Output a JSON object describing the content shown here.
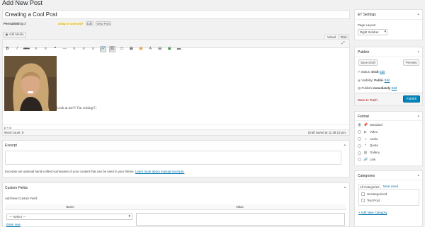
{
  "page": {
    "title": "Add New Post"
  },
  "post": {
    "title": "Creating a Cool Post",
    "permalink_label": "Permalink:",
    "permalink_url": "http://",
    "slug": "using-a-cool-post/",
    "edit_btn": "Edit",
    "view_btn": "View Post"
  },
  "editor": {
    "add_media": "Add Media",
    "tab_visual": "Visual",
    "tab_text": "Text",
    "content": "Look at me!!! I'm writing!!!",
    "path": "p » a",
    "word_count": "Word count: 9",
    "draft_saved": "Draft saved at 11:28:13 pm."
  },
  "excerpt": {
    "title": "Excerpt",
    "help": "Excerpts are optional hand-crafted summaries of your content that can be used in your theme.",
    "help_link": "Learn more about manual excerpts."
  },
  "custom_fields": {
    "title": "Custom Fields",
    "add_new": "Add New Custom Field:",
    "col_name": "Name",
    "col_value": "Value",
    "select_placeholder": "— Select —",
    "enter_new": "Enter new"
  },
  "et_settings": {
    "title": "ET Settings",
    "page_layout_label": "Page Layout:",
    "page_layout_value": "Right Sidebar"
  },
  "publish": {
    "title": "Publish",
    "save_draft": "Save Draft",
    "preview": "Preview",
    "status_label": "Status:",
    "status_value": "Draft",
    "visibility_label": "Visibility:",
    "visibility_value": "Public",
    "publish_label": "Publish",
    "publish_value": "immediately",
    "edit": "Edit",
    "move_trash": "Move to Trash",
    "publish_btn": "Publish"
  },
  "format": {
    "title": "Format",
    "options": [
      {
        "label": "Standard",
        "icon": "pin-icon"
      },
      {
        "label": "Video",
        "icon": "video-icon"
      },
      {
        "label": "Audio",
        "icon": "audio-icon"
      },
      {
        "label": "Quote",
        "icon": "quote-icon"
      },
      {
        "label": "Gallery",
        "icon": "gallery-icon"
      },
      {
        "label": "Link",
        "icon": "link-icon"
      }
    ]
  },
  "categories": {
    "title": "Categories",
    "tab_all": "All Categories",
    "tab_used": "Most Used",
    "items": [
      "Uncategorized",
      "Test Post"
    ],
    "add_new": "+ Add New Category"
  },
  "colors": {
    "accent": "#0073aa",
    "publish_btn": "#0085ba",
    "trash": "#a00"
  }
}
